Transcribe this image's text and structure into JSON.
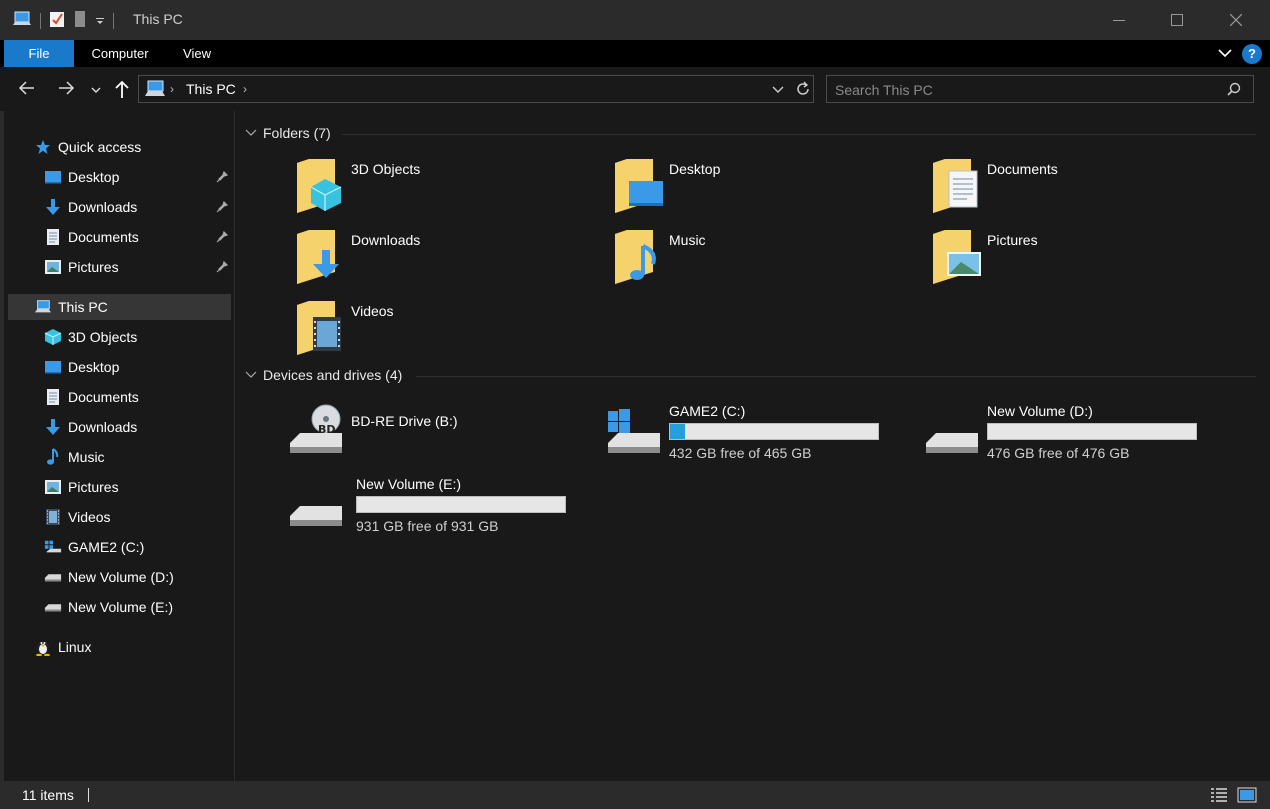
{
  "window": {
    "title": "This PC"
  },
  "ribbon": {
    "tabs": [
      {
        "label": "File",
        "active": true
      },
      {
        "label": "Computer"
      },
      {
        "label": "View"
      }
    ],
    "help": "?"
  },
  "address": {
    "crumbs": [
      "This PC"
    ],
    "search_placeholder": "Search This PC"
  },
  "sidebar": {
    "quick_access": "Quick access",
    "quick_items": [
      "Desktop",
      "Downloads",
      "Documents",
      "Pictures"
    ],
    "this_pc": "This PC",
    "pc_items": [
      "3D Objects",
      "Desktop",
      "Documents",
      "Downloads",
      "Music",
      "Pictures",
      "Videos",
      "GAME2 (C:)",
      "New Volume (D:)",
      "New Volume (E:)"
    ],
    "linux": "Linux"
  },
  "folders": {
    "header": "Folders (7)",
    "items": [
      "3D Objects",
      "Desktop",
      "Documents",
      "Downloads",
      "Music",
      "Pictures",
      "Videos"
    ]
  },
  "devices": {
    "header": "Devices and drives (4)",
    "items": [
      {
        "name": "BD-RE Drive (B:)"
      },
      {
        "name": "GAME2 (C:)",
        "free": "432 GB free of 465 GB",
        "used_fraction": 0.07
      },
      {
        "name": "New Volume (D:)",
        "free": "476 GB free of 476 GB",
        "used_fraction": 0.0
      },
      {
        "name": "New Volume (E:)",
        "free": "931 GB free of 931 GB",
        "used_fraction": 0.0
      }
    ]
  },
  "status": {
    "items": "11 items"
  },
  "colors": {
    "accent": "#1979ca",
    "bar_fill": "#26a0da",
    "folder": "#f6d26c"
  }
}
